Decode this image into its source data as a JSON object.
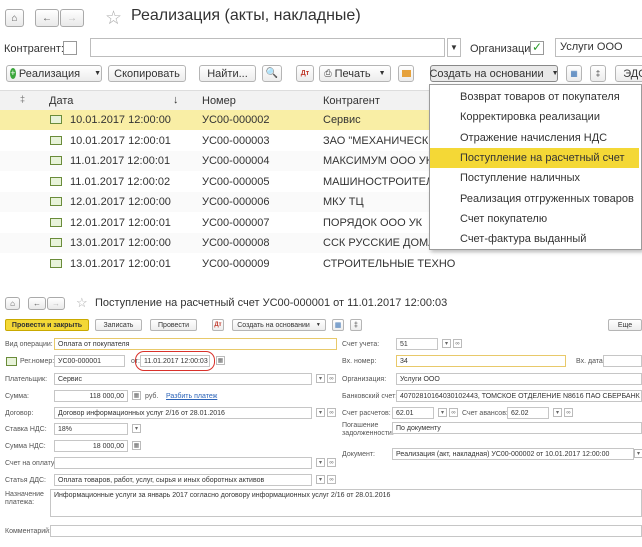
{
  "top": {
    "title": "Реализация (акты, накладные)",
    "filter": {
      "kontragent_label": "Контрагент:",
      "org_label": "Организация:",
      "org_value": "Услуги ООО"
    },
    "toolbar": {
      "realization": "Реализация",
      "copy": "Скопировать",
      "find": "Найти...",
      "print": "Печать",
      "create_based": "Создать на основании",
      "edo": "ЭДО"
    },
    "columns": [
      "Дата",
      "Номер",
      "Контрагент"
    ],
    "rows": [
      {
        "date": "10.01.2017 12:00:00",
        "number": "УС00-000002",
        "kontragent": "Сервис"
      },
      {
        "date": "10.01.2017 12:00:01",
        "number": "УС00-000003",
        "kontragent": "ЗАО \"МЕХАНИЧЕСКИЙ З"
      },
      {
        "date": "11.01.2017 12:00:01",
        "number": "УС00-000004",
        "kontragent": "МАКСИМУМ ООО УК"
      },
      {
        "date": "11.01.2017 12:00:02",
        "number": "УС00-000005",
        "kontragent": "МАШИНОСТРОИТЕЛЬН"
      },
      {
        "date": "12.01.2017 12:00:00",
        "number": "УС00-000006",
        "kontragent": "МКУ ТЦ"
      },
      {
        "date": "12.01.2017 12:00:01",
        "number": "УС00-000007",
        "kontragent": "ПОРЯДОК ООО УК"
      },
      {
        "date": "13.01.2017 12:00:00",
        "number": "УС00-000008",
        "kontragent": "ССК РУССКИЕ ДОМА ОО"
      },
      {
        "date": "13.01.2017 12:00:01",
        "number": "УС00-000009",
        "kontragent": "СТРОИТЕЛЬНЫЕ ТЕХНО"
      }
    ],
    "menu": [
      "Возврат товаров от покупателя",
      "Корректировка реализации",
      "Отражение начисления НДС",
      "Поступление на расчетный счет",
      "Поступление наличных",
      "Реализация отгруженных товаров",
      "Счет покупателю",
      "Счет-фактура выданный"
    ]
  },
  "bottom": {
    "title": "Поступление на расчетный счет УС00-000001 от 11.01.2017 12:00:03",
    "toolbar": {
      "post_close": "Провести и закрыть",
      "save": "Записать",
      "post": "Провести",
      "create_based": "Создать на основании",
      "more": "Еще"
    },
    "left": {
      "op_label": "Вид операции:",
      "op_value": "Оплата от покупателя",
      "reg_label": "Рег.номер:",
      "reg_value": "УС00-000001",
      "from_label": "от:",
      "date_value": "11.01.2017 12:00:03",
      "payer_label": "Плательщик:",
      "payer_value": "Сервис",
      "sum_label": "Сумма:",
      "sum_value": "118 000,00",
      "currency": "руб.",
      "split_link": "Разбить платеж",
      "contract_label": "Договор:",
      "contract_value": "Договор информационных услуг 2/16  от 28.01.2016",
      "vat_rate_label": "Ставка НДС:",
      "vat_rate_value": "18%",
      "vat_sum_label": "Сумма НДС:",
      "vat_sum_value": "18 000,00",
      "invoice_label": "Счет на оплату:",
      "dds_label": "Статья ДДС:",
      "dds_value": "Оплата товаров, работ, услуг, сырья и иных оборотных активов",
      "purpose_label": "Назначение платежа:",
      "purpose_value": "Информационные услуги за январь 2017 согласно договору информационных услуг 2/16  от 28.01.2016",
      "comment_label": "Комментарий:"
    },
    "right": {
      "account_label": "Счет учета:",
      "account_value": "51",
      "in_num_label": "Вх. номер:",
      "in_num_value": "34",
      "in_date_label": "Вх. дата:",
      "org_label": "Организация:",
      "org_value": "Услуги ООО",
      "bank_label": "Банковский счет:",
      "bank_value": "40702810164030102443, ТОМСКОЕ ОТДЕЛЕНИЕ N8616 ПАО СБЕРБАНК",
      "calc_label": "Счет расчетов:",
      "calc_value": "62.01",
      "adv_label": "Счет авансов:",
      "adv_value": "62.02",
      "debt_label": "Погашение задолженности:",
      "debt_value": "По документу",
      "doc_label": "Документ:",
      "doc_value": "Реализация (акт, накладная) УС00-000002 от 10.01.2017 12:00:00"
    }
  }
}
